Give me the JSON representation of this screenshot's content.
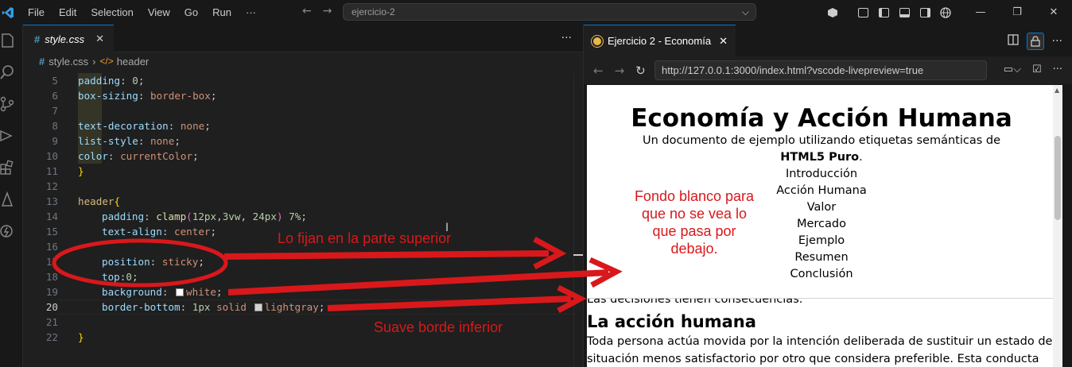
{
  "menu": [
    "File",
    "Edit",
    "Selection",
    "View",
    "Go",
    "Run",
    "···"
  ],
  "command_center": {
    "text": "ejercicio-2"
  },
  "editor": {
    "tab_label": "style.css",
    "breadcrumb": {
      "file": "style.css",
      "symbol": "header"
    },
    "lines": [
      {
        "n": "5"
      },
      {
        "n": "6"
      },
      {
        "n": "7"
      },
      {
        "n": "8"
      },
      {
        "n": "9"
      },
      {
        "n": "10"
      },
      {
        "n": "11"
      },
      {
        "n": "12"
      },
      {
        "n": "13"
      },
      {
        "n": "14"
      },
      {
        "n": "15"
      },
      {
        "n": "16"
      },
      {
        "n": "17"
      },
      {
        "n": "18"
      },
      {
        "n": "19"
      },
      {
        "n": "20"
      },
      {
        "n": "21"
      },
      {
        "n": "22"
      }
    ]
  },
  "preview": {
    "tab_label": "Ejercicio 2 - Economía",
    "url": "http://127.0.0.1:3000/index.html?vscode-livepreview=true",
    "page": {
      "title": "Economía y Acción Humana",
      "subtitle_pre": "Un documento de ejemplo utilizando etiquetas semánticas de ",
      "subtitle_bold": "HTML5 Puro",
      "subtitle_post": ".",
      "nav": [
        "Introducción",
        "Acción Humana",
        "Valor",
        "Mercado",
        "Ejemplo",
        "Resumen",
        "Conclusión"
      ],
      "hidden_text": "Las decisiones tienen consecuencias.",
      "h2": "La acción humana",
      "paragraph": "Toda persona actúa movida por la intención deliberada de sustituir un estado de situación menos satisfactorio por otro que considera preferible. Esta conducta"
    }
  },
  "annotations": {
    "top": "Lo fijan en la parte superior",
    "box": "Fondo blanco para que no se vea lo que pasa por debajo.",
    "bottom": "Suave borde inferior",
    "color": "#d9181b"
  }
}
